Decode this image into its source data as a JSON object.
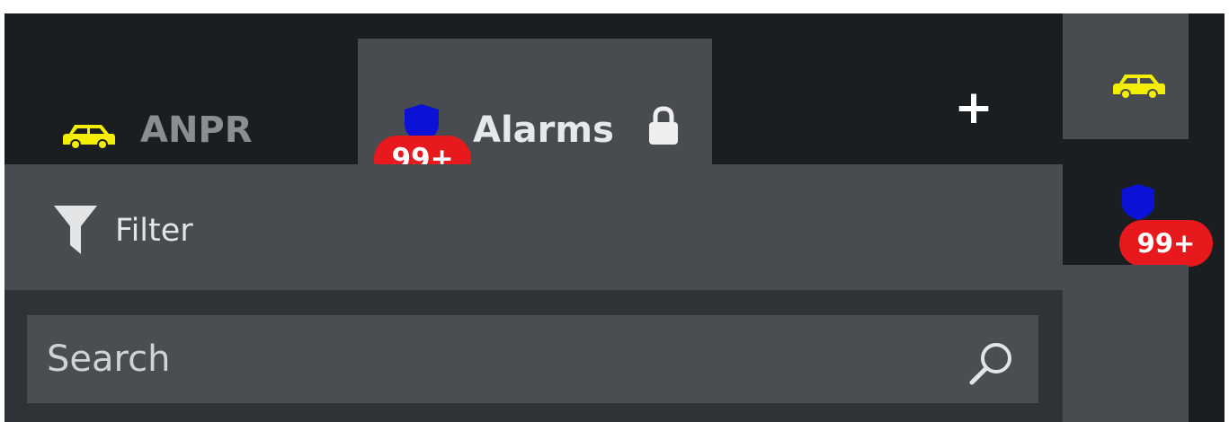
{
  "tabs": [
    {
      "label": "ANPR",
      "icon": "car-icon",
      "active": false
    },
    {
      "label": "Alarms",
      "icon": "shield-icon",
      "badge": "99+",
      "locked": true,
      "active": true
    }
  ],
  "add_tab": {
    "label": "+"
  },
  "filter": {
    "label": "Filter",
    "icon": "filter-icon"
  },
  "search": {
    "placeholder": "Search",
    "icon": "search-icon"
  },
  "side_rail": {
    "items": [
      {
        "icon": "car-icon"
      },
      {
        "icon": "shield-icon",
        "badge": "99+"
      }
    ]
  },
  "colors": {
    "car_yellow": "#f4ef00",
    "shield_blue": "#0b12d6",
    "badge_red": "#e8191d",
    "active_tab": "#484c50",
    "dark_background": "#1b1e21"
  }
}
